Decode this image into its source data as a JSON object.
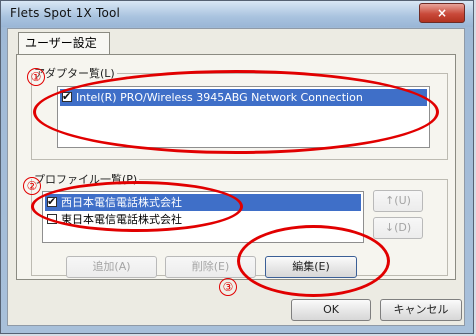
{
  "window": {
    "title": "Flets Spot 1X Tool",
    "close_symbol": "×"
  },
  "tab": {
    "label": "ユーザー設定"
  },
  "adapter": {
    "group_label": "アダプター覧(L)",
    "items": [
      {
        "checked": true,
        "label": "Intel(R) PRO/Wireless 3945ABG Network Connection"
      }
    ]
  },
  "profiles": {
    "group_label": "プロファイル一覧(P)",
    "items": [
      {
        "checked": true,
        "label": "西日本電信電話株式会社"
      },
      {
        "checked": false,
        "label": "東日本電信電話株式会社"
      }
    ]
  },
  "buttons": {
    "up": "↑(U)",
    "down": "↓(D)",
    "add": "追加(A)",
    "delete": "削除(E)",
    "edit": "編集(E)",
    "ok": "OK",
    "cancel": "キャンセル"
  },
  "annotations": [
    "①",
    "②",
    "③"
  ],
  "colors": {
    "annotation": "#e10000",
    "selection": "#3f6fc8"
  }
}
